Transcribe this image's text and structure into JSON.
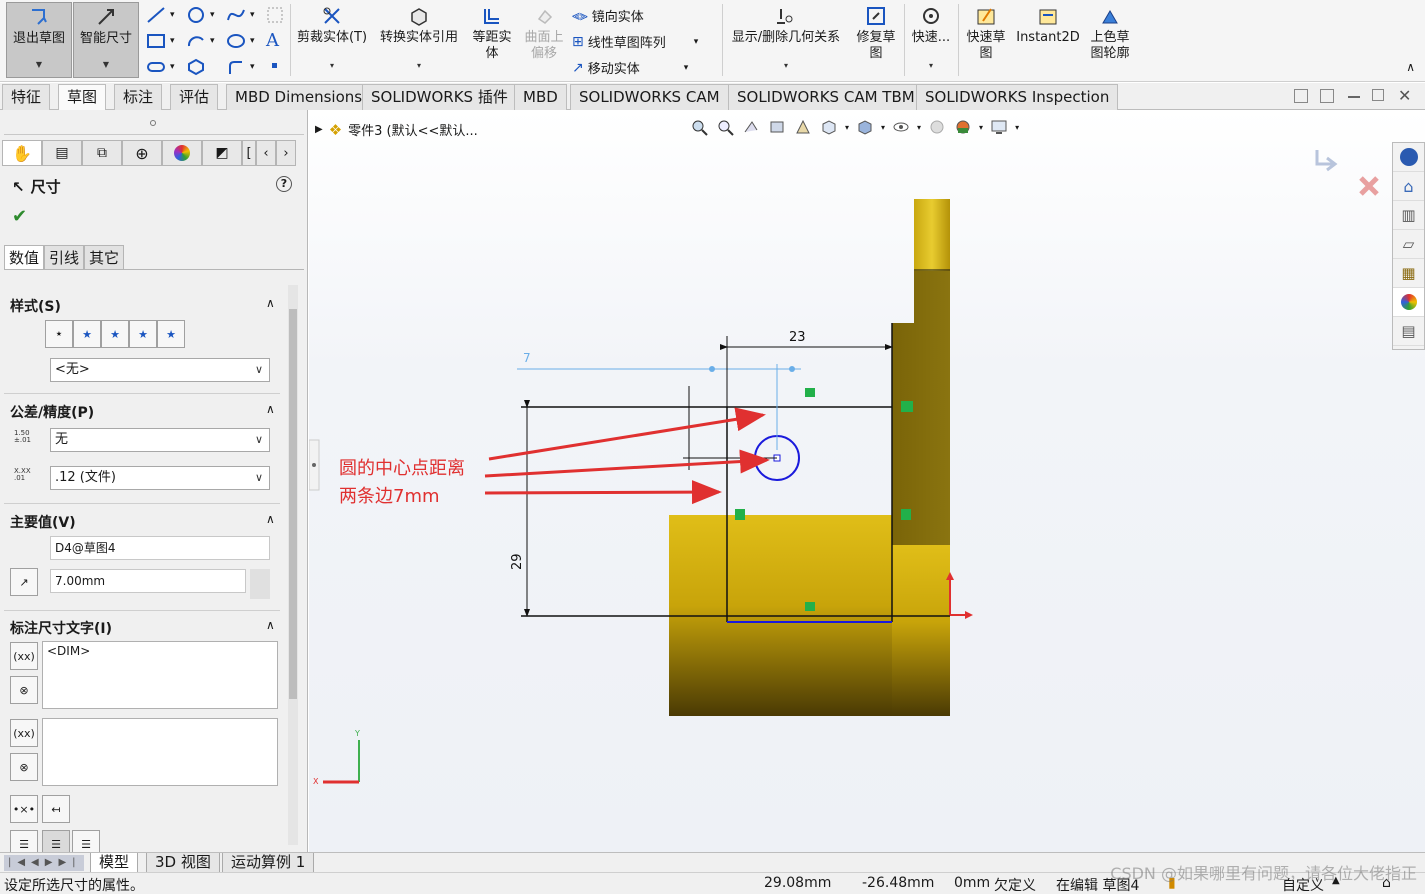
{
  "ribbon": {
    "exit_sketch": "退出草图",
    "smart_dim": "智能尺寸",
    "trim": "剪裁实体(T)",
    "convert": "转换实体引用",
    "offset_line1": "等距实",
    "offset_line2": "体",
    "surface_offset_line1": "曲面上",
    "surface_offset_line2": "偏移",
    "mirror": "镜向实体",
    "linear_pattern": "线性草图阵列",
    "move": "移动实体",
    "relations": "显示/删除几何关系",
    "repair_line1": "修复草",
    "repair_line2": "图",
    "quick_snaps": "快速...",
    "rapid_sketch_line1": "快速草",
    "rapid_sketch_line2": "图",
    "instant2d": "Instant2D",
    "shaded_line1": "上色草",
    "shaded_line2": "图轮廓"
  },
  "tabs": [
    "特征",
    "草图",
    "标注",
    "评估",
    "MBD Dimensions",
    "SOLIDWORKS 插件",
    "MBD",
    "SOLIDWORKS CAM",
    "SOLIDWORKS CAM TBM",
    "SOLIDWORKS Inspection"
  ],
  "panel": {
    "title": "尺寸",
    "sub_tabs": [
      "数值",
      "引线",
      "其它"
    ],
    "style_header": "样式(S)",
    "style_value": "<无>",
    "tolerance_header": "公差/精度(P)",
    "tolerance_value": "无",
    "precision_value": ".12 (文件)",
    "primary_header": "主要值(V)",
    "primary_name": "D4@草图4",
    "primary_value": "7.00mm",
    "dimtext_header": "标注尺寸文字(I)",
    "dimtext_value": "<DIM>",
    "tol_icon_text": "1.50 ±.01",
    "prec_icon_text": "X.XX .01"
  },
  "graphics": {
    "doc_name": "零件3  (默认<<默认...",
    "annotation_line1": "圆的中心点距离",
    "annotation_line2": "两条边7mm",
    "dim_23": "23",
    "dim_29": "29",
    "dim_7": "7"
  },
  "bottom_tabs": [
    "模型",
    "3D 视图",
    "运动算例 1"
  ],
  "status": {
    "hint": "设定所选尺寸的属性。",
    "x": "29.08mm",
    "y": "-26.48mm",
    "z": "0mm",
    "state": "欠定义",
    "editing": "在编辑 草图4",
    "units": "自定义",
    "watermark": "CSDN @如果哪里有问题，请各位大佬指正"
  },
  "colors": {
    "part_gold": "#c8a40a",
    "part_dark": "#7a6408",
    "sketch_blue": "#1a1adc",
    "annotation_red": "#e03030",
    "relation_green": "#22b04a"
  }
}
